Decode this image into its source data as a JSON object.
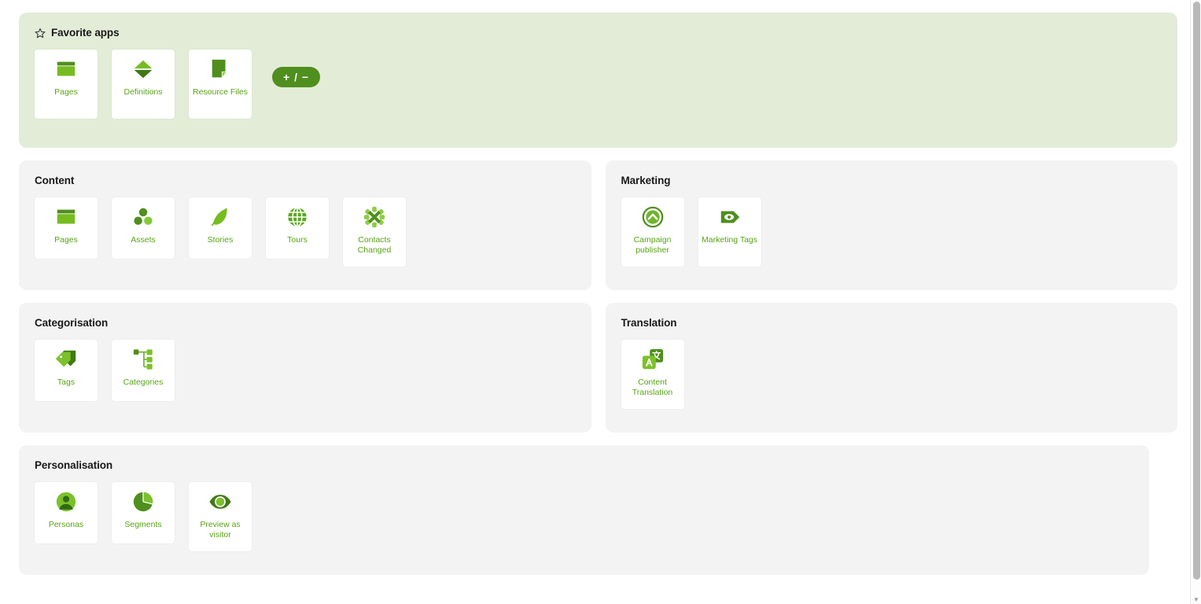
{
  "colors": {
    "accent_dark": "#4f8f1e",
    "accent_light": "#76bc21",
    "label_green": "#57a515",
    "favorites_bg": "#e3ecd7",
    "panel_bg": "#f3f3f3",
    "tile_bg": "#ffffff",
    "page_bg": "#ffffff",
    "heading": "#1a1a1a"
  },
  "favorites": {
    "title": "Favorite apps",
    "star_icon": "star-outline-icon",
    "edit_pill_label": "+ / −",
    "apps": [
      {
        "label": "Pages",
        "icon": "pages-card-icon"
      },
      {
        "label": "Definitions",
        "icon": "definitions-diamond-icon"
      },
      {
        "label": "Resource Files",
        "icon": "resource-file-icon"
      }
    ]
  },
  "groups": [
    {
      "id": "content",
      "title": "Content",
      "apps": [
        {
          "label": "Pages",
          "icon": "pages-card-icon"
        },
        {
          "label": "Assets",
          "icon": "assets-circles-icon"
        },
        {
          "label": "Stories",
          "icon": "stories-leaf-icon"
        },
        {
          "label": "Tours",
          "icon": "tours-globe-icon"
        },
        {
          "label": "Contacts Changed",
          "icon": "contacts-changed-asterisk-icon"
        }
      ]
    },
    {
      "id": "marketing",
      "title": "Marketing",
      "apps": [
        {
          "label": "Campaign publisher",
          "icon": "campaign-publisher-circle-up-icon"
        },
        {
          "label": "Marketing Tags",
          "icon": "marketing-tag-eye-icon"
        }
      ]
    },
    {
      "id": "categorisation",
      "title": "Categorisation",
      "apps": [
        {
          "label": "Tags",
          "icon": "tags-icon"
        },
        {
          "label": "Categories",
          "icon": "categories-tree-icon"
        }
      ]
    },
    {
      "id": "translation",
      "title": "Translation",
      "apps": [
        {
          "label": "Content Translation",
          "icon": "content-translation-icon"
        }
      ]
    },
    {
      "id": "personalisation",
      "title": "Personalisation",
      "apps": [
        {
          "label": "Personas",
          "icon": "personas-avatar-icon"
        },
        {
          "label": "Segments",
          "icon": "segments-pie-icon"
        },
        {
          "label": "Preview as visitor",
          "icon": "preview-eye-icon"
        }
      ]
    }
  ],
  "scrollbar": {
    "up_arrow": "▲",
    "down_arrow": "▼"
  }
}
